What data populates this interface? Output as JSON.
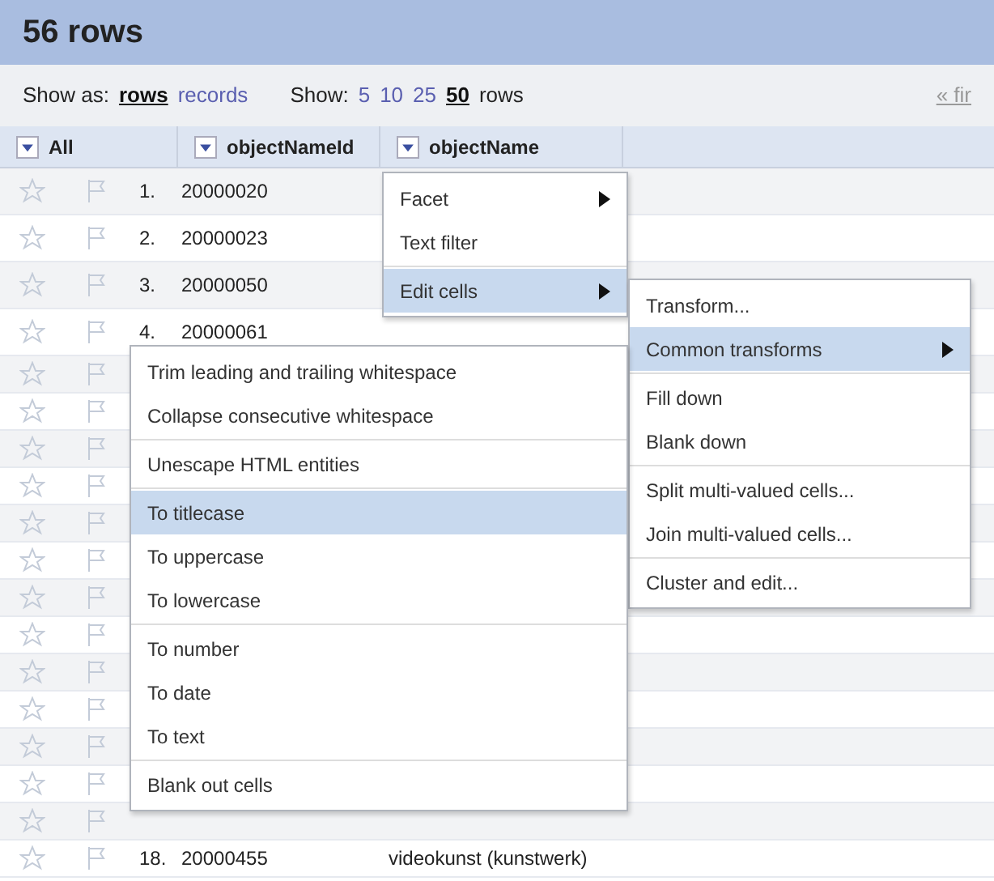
{
  "header": {
    "title": "56 rows"
  },
  "options": {
    "show_as_label": "Show as:",
    "views": [
      {
        "label": "rows",
        "selected": true
      },
      {
        "label": "records",
        "selected": false
      }
    ],
    "show_label": "Show:",
    "sizes": [
      {
        "label": "5",
        "selected": false
      },
      {
        "label": "10",
        "selected": false
      },
      {
        "label": "25",
        "selected": false
      },
      {
        "label": "50",
        "selected": true
      }
    ],
    "sizes_suffix": "rows",
    "pager": "« fir"
  },
  "columns": [
    {
      "label": "All"
    },
    {
      "label": "objectNameId"
    },
    {
      "label": "objectName"
    }
  ],
  "rows": [
    {
      "starred": false,
      "flagged": false,
      "number": "1.",
      "id": "20000020"
    },
    {
      "starred": false,
      "flagged": false,
      "number": "2.",
      "id": "20000023"
    },
    {
      "starred": false,
      "flagged": false,
      "number": "3.",
      "id": "20000050"
    },
    {
      "starred": false,
      "flagged": false,
      "number": "4.",
      "id": "20000061"
    },
    {
      "starred": false,
      "flagged": false
    },
    {
      "starred": false,
      "flagged": false
    },
    {
      "starred": false,
      "flagged": false
    },
    {
      "starred": false,
      "flagged": false
    },
    {
      "starred": false,
      "flagged": false
    },
    {
      "starred": false,
      "flagged": false
    },
    {
      "starred": false,
      "flagged": false
    },
    {
      "starred": false,
      "flagged": false
    },
    {
      "starred": false,
      "flagged": false
    },
    {
      "starred": false,
      "flagged": false
    },
    {
      "starred": false,
      "flagged": false
    },
    {
      "starred": false,
      "flagged": false
    },
    {
      "starred": false,
      "flagged": false
    },
    {
      "starred": false,
      "flagged": false,
      "number": "18.",
      "id": "20000455",
      "name": "videokunst (kunstwerk)"
    }
  ],
  "menu": [
    {
      "kind": "item",
      "label": "Facet",
      "submenu": true,
      "selected": false
    },
    {
      "kind": "item",
      "label": "Text filter",
      "submenu": false,
      "selected": false
    },
    {
      "kind": "separator"
    },
    {
      "kind": "item",
      "label": "Edit cells",
      "submenu": true,
      "selected": true
    }
  ],
  "edit_cells_menu": [
    {
      "kind": "item",
      "label": "Transform...",
      "submenu": false,
      "selected": false
    },
    {
      "kind": "item",
      "label": "Common transforms",
      "submenu": true,
      "selected": true
    },
    {
      "kind": "separator"
    },
    {
      "kind": "item",
      "label": "Fill down",
      "submenu": false,
      "selected": false
    },
    {
      "kind": "item",
      "label": "Blank down",
      "submenu": false,
      "selected": false
    },
    {
      "kind": "separator"
    },
    {
      "kind": "item",
      "label": "Split multi-valued cells...",
      "submenu": false,
      "selected": false
    },
    {
      "kind": "item",
      "label": "Join multi-valued cells...",
      "submenu": false,
      "selected": false
    },
    {
      "kind": "separator"
    },
    {
      "kind": "item",
      "label": "Cluster and edit...",
      "submenu": false,
      "selected": false
    }
  ],
  "common_transforms_menu": [
    {
      "kind": "item",
      "label": "Trim leading and trailing whitespace",
      "submenu": false,
      "selected": false
    },
    {
      "kind": "item",
      "label": "Collapse consecutive whitespace",
      "submenu": false,
      "selected": false
    },
    {
      "kind": "separator"
    },
    {
      "kind": "item",
      "label": "Unescape HTML entities",
      "submenu": false,
      "selected": false
    },
    {
      "kind": "separator"
    },
    {
      "kind": "item",
      "label": "To titlecase",
      "submenu": false,
      "selected": true
    },
    {
      "kind": "item",
      "label": "To uppercase",
      "submenu": false,
      "selected": false
    },
    {
      "kind": "item",
      "label": "To lowercase",
      "submenu": false,
      "selected": false
    },
    {
      "kind": "separator"
    },
    {
      "kind": "item",
      "label": "To number",
      "submenu": false,
      "selected": false
    },
    {
      "kind": "item",
      "label": "To date",
      "submenu": false,
      "selected": false
    },
    {
      "kind": "item",
      "label": "To text",
      "submenu": false,
      "selected": false
    },
    {
      "kind": "separator"
    },
    {
      "kind": "item",
      "label": "Blank out cells",
      "submenu": false,
      "selected": false
    }
  ]
}
